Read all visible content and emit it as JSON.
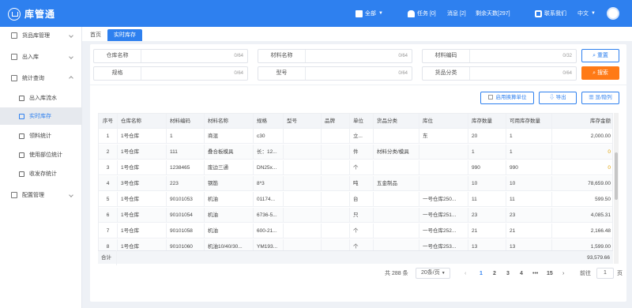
{
  "header": {
    "app_name": "库管通",
    "warehouse_label": "全部",
    "tasks": "任务 [0]",
    "messages": "消息 [2]",
    "remaining": "剩余天数[297]",
    "contact": "联系我们",
    "language": "中文"
  },
  "sidebar": {
    "items": [
      {
        "label": "货品库管理",
        "icon": "box-icon"
      },
      {
        "label": "出入库",
        "icon": "inout-icon"
      },
      {
        "label": "统计查询",
        "icon": "stats-icon"
      },
      {
        "label": "出入库流水",
        "icon": "flow-icon"
      },
      {
        "label": "实时库存",
        "icon": "inventory-icon"
      },
      {
        "label": "领料统计",
        "icon": "picking-icon"
      },
      {
        "label": "使用部位统计",
        "icon": "usage-icon"
      },
      {
        "label": "收发存统计",
        "icon": "balance-icon"
      },
      {
        "label": "配置管理",
        "icon": "config-icon"
      }
    ]
  },
  "tabs": {
    "home": "首页",
    "current": "实时库存"
  },
  "filters": {
    "warehouse_name": {
      "label": "仓库名称",
      "count": "0/64"
    },
    "material_name": {
      "label": "材料名称",
      "count": "0/64"
    },
    "material_code": {
      "label": "材料编码",
      "count": "0/32"
    },
    "spec": {
      "label": "规格",
      "count": "0/64"
    },
    "model": {
      "label": "型号",
      "count": "0/64"
    },
    "category": {
      "label": "货品分类",
      "count": "0/64"
    },
    "reset": "重置",
    "search": "搜索"
  },
  "toolbar": {
    "convert_unit": "启用换算单位",
    "export": "导出",
    "columns": "显/隐列"
  },
  "table": {
    "headers": [
      "序号",
      "仓库名称",
      "材料编码",
      "材料名称",
      "规格",
      "型号",
      "品牌",
      "单位",
      "货品分类",
      "库位",
      "库存数量",
      "可用库存数量",
      "库存金额"
    ],
    "rows": [
      [
        "1",
        "1号仓库",
        "1",
        "商混",
        "c30",
        "",
        "",
        "立...",
        "",
        "东",
        "20",
        "1",
        "2,000.00"
      ],
      [
        "2",
        "1号仓库",
        "111",
        "叠合板模具",
        "长：12...",
        "",
        "",
        "件",
        "材料分类/模具",
        "",
        "1",
        "1",
        "0"
      ],
      [
        "3",
        "1号仓库",
        "1238465",
        "废边三通",
        "DN25x...",
        "",
        "",
        "个",
        "",
        "",
        "990",
        "990",
        "0"
      ],
      [
        "4",
        "3号仓库",
        "223",
        "钢筋",
        "8*3",
        "",
        "",
        "吨",
        "五金制品",
        "",
        "10",
        "10",
        "78,659.00"
      ],
      [
        "5",
        "1号仓库",
        "90101053",
        "机油",
        "01174...",
        "",
        "",
        "台",
        "",
        "一号仓库250...",
        "11",
        "11",
        "599.50"
      ],
      [
        "6",
        "1号仓库",
        "90101054",
        "机油",
        "6736-5...",
        "",
        "",
        "只",
        "",
        "一号仓库251...",
        "23",
        "23",
        "4,085.31"
      ],
      [
        "7",
        "1号仓库",
        "90101058",
        "机油",
        "600-21...",
        "",
        "",
        "个",
        "",
        "一号仓库252...",
        "21",
        "21",
        "2,166.48"
      ],
      [
        "8",
        "1号仓库",
        "90101060",
        "机油10/40/30...",
        "YM193...",
        "",
        "",
        "个",
        "",
        "一号仓库253...",
        "13",
        "13",
        "1,599.00"
      ]
    ],
    "total_label": "合计",
    "total_amount": "93,579.66"
  },
  "pagination": {
    "total": "共 288 条",
    "page_size": "20条/页",
    "pages": [
      "1",
      "2",
      "3",
      "4",
      "•••",
      "15"
    ],
    "current": "1",
    "goto_label": "前往",
    "goto_value": "1",
    "goto_suffix": "页"
  },
  "colors": {
    "primary": "#2e80ef",
    "accent": "#ff7a16",
    "zero_value": "#e0a000"
  }
}
